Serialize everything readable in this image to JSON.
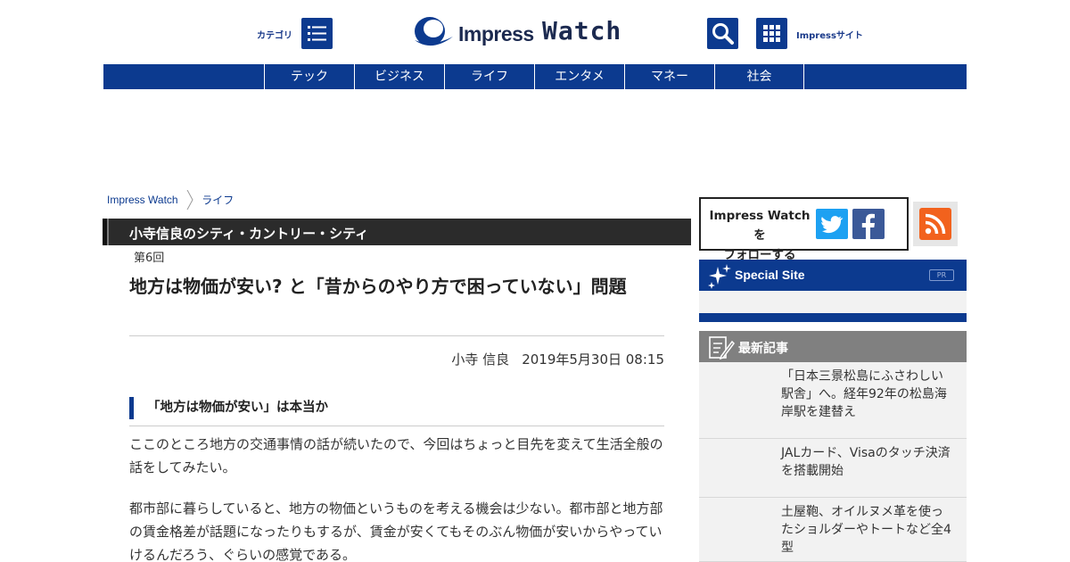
{
  "header": {
    "category_label": "カテゴリ",
    "logo_text_1": "Impress",
    "logo_text_2": "Watch",
    "impress_sites_label": "Impressサイト"
  },
  "nav": {
    "items": [
      "テック",
      "ビジネス",
      "ライフ",
      "エンタメ",
      "マネー",
      "社会"
    ]
  },
  "breadcrumb": {
    "items": [
      "Impress Watch",
      "ライフ"
    ]
  },
  "article": {
    "series": "小寺信良のシティ・カントリー・シティ",
    "episode": "第6回",
    "title": "地方は物価が安い? と「昔からのやり方で困っていない」問題",
    "author": "小寺 信良",
    "date": "2019年5月30日 08:15",
    "section_heading": "「地方は物価が安い」は本当か",
    "paragraphs": [
      "ここのところ地方の交通事情の話が続いたので、今回はちょっと目先を変えて生活全般の話をしてみたい。",
      "都市部に暮らしていると、地方の物価というものを考える機会は少ない。都市部と地方部の賃金格差が話題になったりもするが、賃金が安くてもそのぶん物価が安いからやっていけるんだろう、ぐらいの感覚である。"
    ]
  },
  "sidebar": {
    "follow_line1": "Impress Watch を",
    "follow_line2": "フォローする",
    "special_title": "Special Site",
    "pr_label": "PR",
    "latest_title": "最新記事",
    "latest_items": [
      "「日本三景松島にふさわしい駅舎」へ。経年92年の松島海岸駅を建替え",
      "JALカード、Visaのタッチ決済を搭載開始",
      "土屋鞄、オイルヌメ革を使ったショルダーやトートなど全4型"
    ]
  },
  "colors": {
    "brand_blue": "#0c3a8f",
    "twitter": "#1da1f2",
    "facebook": "#3b5998",
    "rss": "#f2621d"
  }
}
